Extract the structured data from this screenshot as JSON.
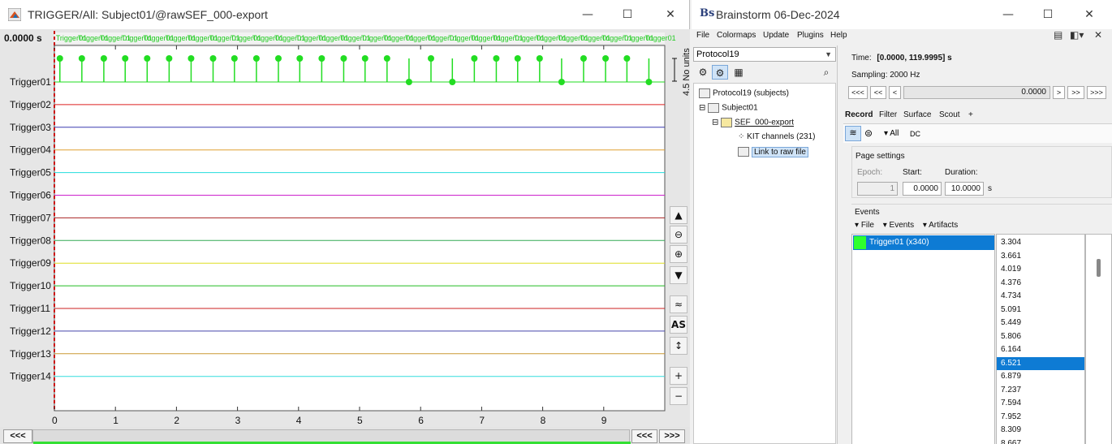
{
  "left_window": {
    "title": "TRIGGER/All: Subject01/@rawSEF_000-export",
    "time_readout": "0.0000 s",
    "amplitude_label": "4.5 No units",
    "channels": [
      "Trigger01",
      "Trigger02",
      "Trigger03",
      "Trigger04",
      "Trigger05",
      "Trigger06",
      "Trigger07",
      "Trigger08",
      "Trigger09",
      "Trigger10",
      "Trigger11",
      "Trigger12",
      "Trigger13",
      "Trigger14"
    ],
    "channel_colors": [
      "#22dd22",
      "#dd2222",
      "#3b3bb0",
      "#e0a030",
      "#22dddd",
      "#cc22cc",
      "#aa2222",
      "#33aa55",
      "#dddd22",
      "#22bb22",
      "#cc2222",
      "#4444aa",
      "#cc9933",
      "#33dddd"
    ],
    "x_ticks": [
      "0",
      "1",
      "2",
      "3",
      "4",
      "5",
      "6",
      "7",
      "8",
      "9"
    ],
    "x_tick_values": [
      0,
      1,
      2,
      3,
      4,
      5,
      6,
      7,
      8,
      9
    ],
    "x_range": [
      0,
      10
    ],
    "event_label": "Trigger01",
    "spike_times": [
      0.09,
      0.45,
      0.81,
      1.16,
      1.52,
      1.88,
      2.24,
      2.6,
      2.95,
      3.31,
      3.67,
      4.02,
      4.38,
      4.74,
      5.09,
      5.45,
      5.81,
      6.17,
      6.52,
      6.88,
      7.24,
      7.59,
      7.95,
      8.31,
      8.67,
      9.03,
      9.38,
      9.74
    ],
    "spike_down_times": [
      5.81,
      6.52,
      8.31,
      9.74
    ],
    "side_buttons": [
      "▲",
      "⊖",
      "⊕",
      "▼",
      "≈",
      "AS",
      "↕",
      "+",
      "−"
    ],
    "scroll_buttons": {
      "first": "<<<",
      "prev": "<<<",
      "next": ">>>"
    }
  },
  "right_window": {
    "title": "Brainstorm 06-Dec-2024",
    "menu": [
      "File",
      "Colormaps",
      "Update",
      "Plugins",
      "Help"
    ],
    "protocol": "Protocol19",
    "tree": {
      "root": "Protocol19 (subjects)",
      "subject": "Subject01",
      "dataset": "SEF_000-export",
      "channels": "KIT channels (231)",
      "link": "Link to raw file"
    },
    "time_label": "Time:",
    "time_value": "[0.0000, 119.9995] s",
    "sampling": "Sampling: 2000 Hz",
    "nav_buttons": [
      "<<<",
      "<<",
      "<",
      ">",
      ">>",
      ">>>"
    ],
    "time_field": "0.0000",
    "tabs": [
      "Record",
      "Filter",
      "Surface",
      "Scout",
      "+"
    ],
    "toolrow": {
      "all": "All",
      "dc": "DC"
    },
    "page_settings": {
      "title": "Page settings",
      "epoch_label": "Epoch:",
      "epoch_value": "1",
      "start_label": "Start:",
      "start_value": "0.0000",
      "duration_label": "Duration:",
      "duration_value": "10.0000",
      "unit": "s"
    },
    "events": {
      "title": "Events",
      "menu": [
        "File",
        "Events",
        "Artifacts"
      ],
      "item": "Trigger01  (x340)",
      "item_color": "#2eff2e",
      "times": [
        "3.304",
        "3.661",
        "4.019",
        "4.376",
        "4.734",
        "5.091",
        "5.449",
        "5.806",
        "6.164",
        "6.521",
        "6.879",
        "7.237",
        "7.594",
        "7.952",
        "8.309",
        "8.667"
      ],
      "selected_time": "6.521"
    }
  }
}
